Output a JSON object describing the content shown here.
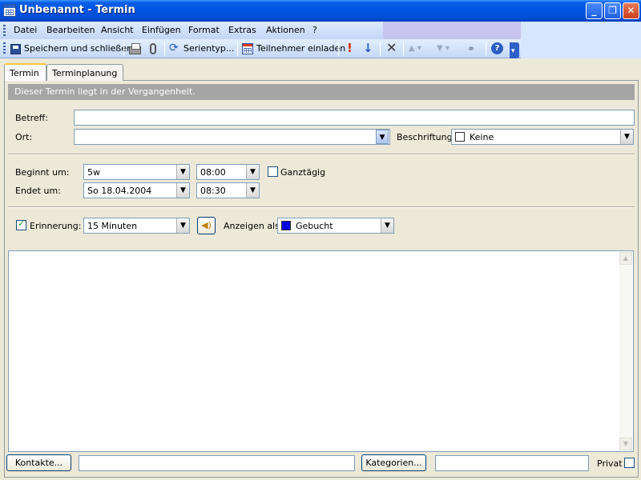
{
  "window": {
    "title": "Unbenannt - Termin",
    "minimize_icon": "minimize-icon",
    "maximize_icon": "restore-icon",
    "close_icon": "close-icon"
  },
  "menu": {
    "items": [
      {
        "label": "Datei"
      },
      {
        "label": "Bearbeiten"
      },
      {
        "label": "Ansicht"
      },
      {
        "label": "Einfügen"
      },
      {
        "label": "Format"
      },
      {
        "label": "Extras"
      },
      {
        "label": "Aktionen"
      },
      {
        "label": "?"
      }
    ]
  },
  "toolbar": {
    "save_close": "Speichern und schließen",
    "recurrence": "Serientyp...",
    "invite": "Teilnehmer einladen"
  },
  "tabs": [
    {
      "label": "Termin"
    },
    {
      "label": "Terminplanung"
    }
  ],
  "info": {
    "message": "Dieser Termin liegt in der Vergangenheit."
  },
  "form": {
    "subject_label": "Betreff:",
    "subject_value": "",
    "location_label": "Ort:",
    "location_value": "",
    "label_label": "Beschriftung:",
    "label_value": "Keine",
    "start_label": "Beginnt um:",
    "start_date": "5w",
    "start_time": "08:00",
    "allday_label": "Ganztägig",
    "allday_checked": false,
    "end_label": "Endet um:",
    "end_date": "So 18.04.2004",
    "end_time": "08:30",
    "reminder_label": "Erinnerung:",
    "reminder_checked": true,
    "reminder_value": "15 Minuten",
    "showas_label": "Anzeigen als:",
    "showas_value": "Gebucht",
    "showas_color": "#0000e0",
    "notes_value": ""
  },
  "footer": {
    "contacts_button": "Kontakte...",
    "contacts_value": "",
    "categories_button": "Kategorien...",
    "categories_value": "",
    "private_label": "Privat",
    "private_checked": false
  }
}
